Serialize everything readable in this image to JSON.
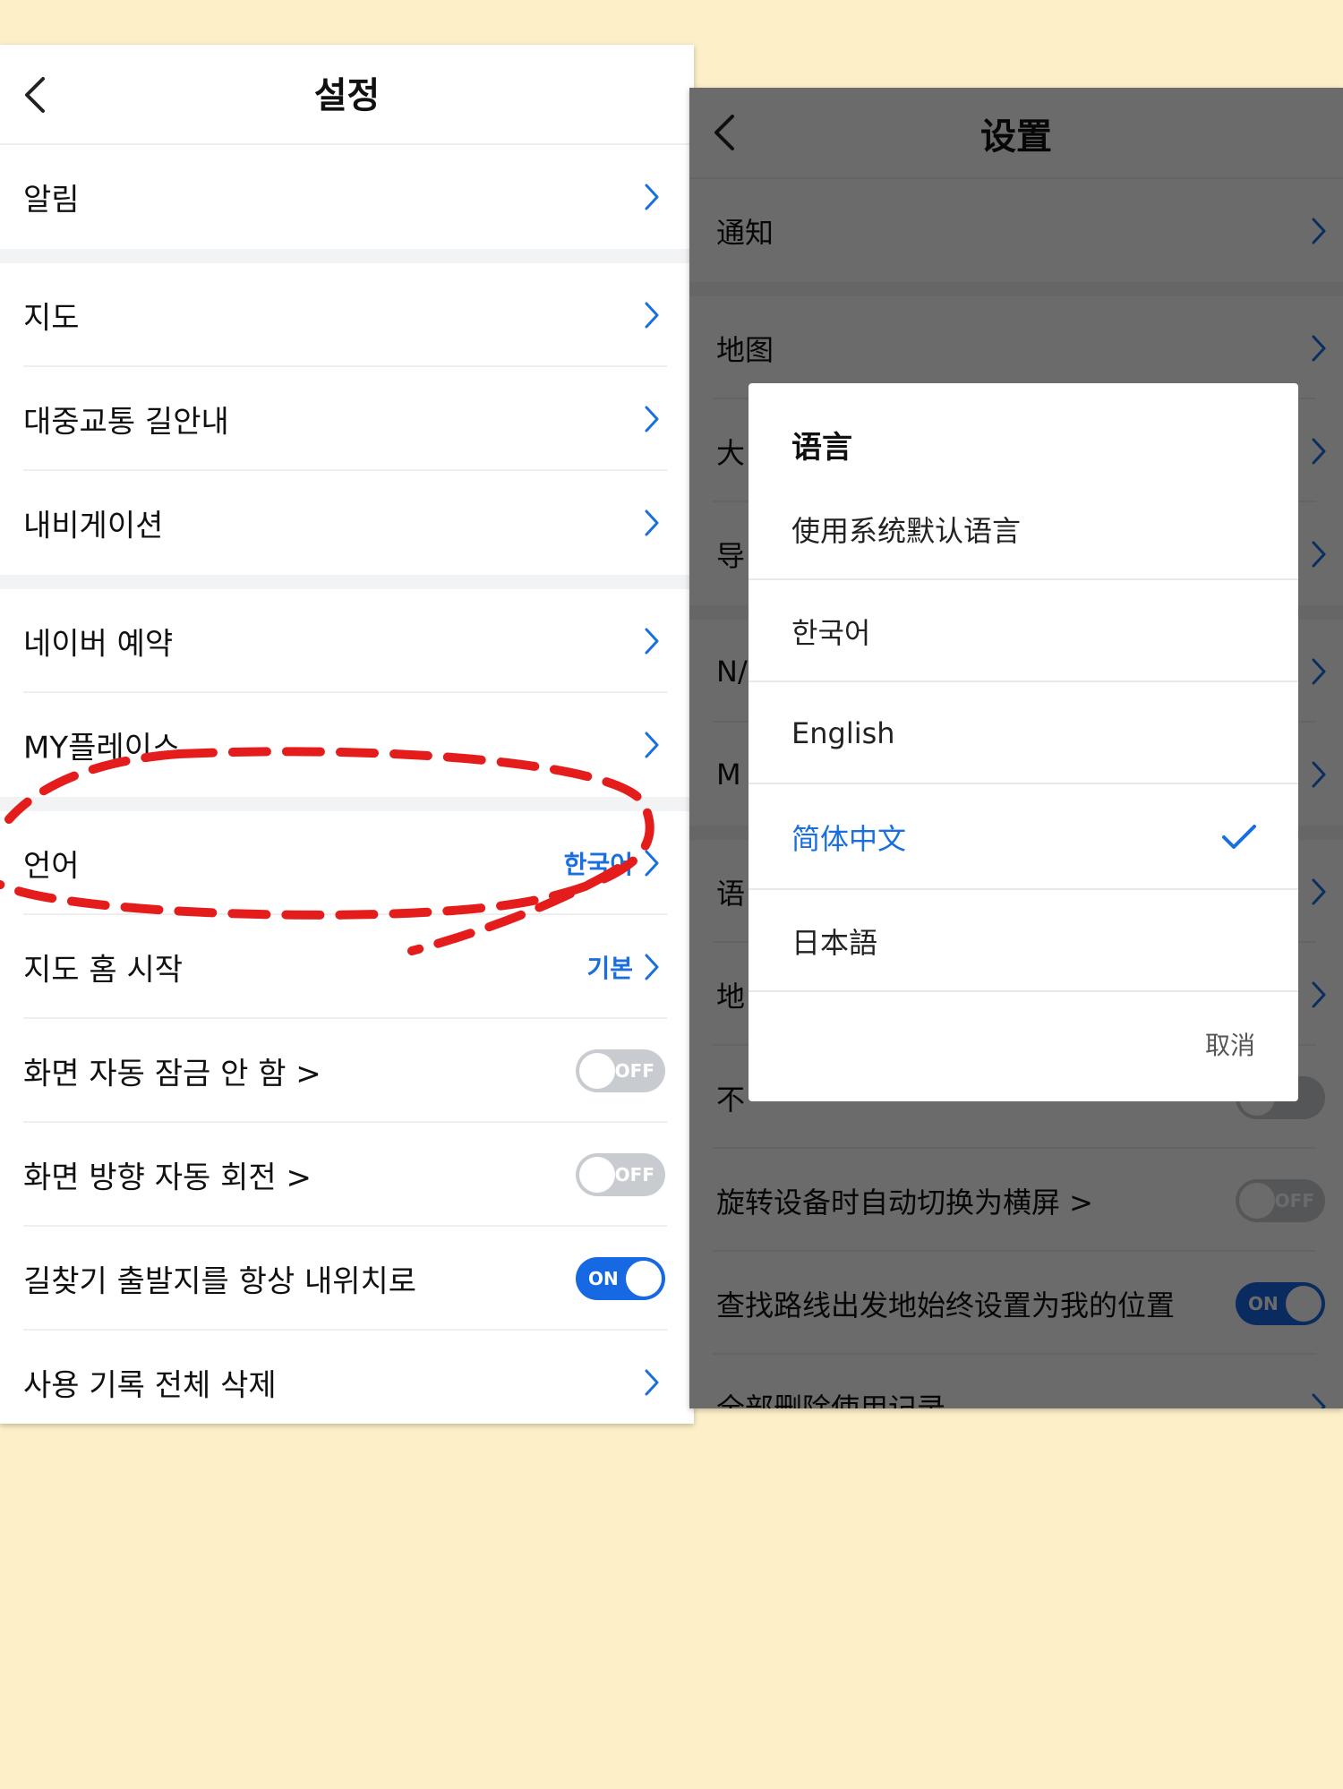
{
  "left_screen": {
    "title": "설정",
    "rows": {
      "notifications": "알림",
      "map": "지도",
      "transit": "대중교통 길안내",
      "navigation": "내비게이션",
      "naver_booking": "네이버 예약",
      "my_place": "MY플레이스",
      "language": "언어",
      "language_value": "한국어",
      "map_home": "지도 홈 시작",
      "map_home_value": "기본",
      "auto_lock": "화면 자동 잠금 안 함 >",
      "auto_lock_toggle": "OFF",
      "auto_rotate": "화면 방향 자동 회전 >",
      "auto_rotate_toggle": "OFF",
      "start_my_location": "길찾기 출발지를 항상 내위치로",
      "start_my_location_toggle": "ON",
      "clear_history": "사용 기록 전체 삭제"
    }
  },
  "right_screen": {
    "title": "设置",
    "rows": {
      "notifications": "通知",
      "map": "地图",
      "transit_partial": "大",
      "navigation_partial": "导",
      "naver_partial": "N/",
      "my_place_partial": "M",
      "language_partial": "语",
      "map_home_partial": "地",
      "auto_lock_partial": "不",
      "auto_rotate": "旋转设备时自动切换为横屏 >",
      "auto_rotate_toggle": "OFF",
      "start_my_location": "查找路线出发地始终设置为我的位置",
      "start_my_location_toggle": "ON",
      "clear_history": "全部删除使用记录"
    },
    "language_dialog": {
      "title": "语言",
      "options": [
        "使用系统默认语言",
        "한국어",
        "English",
        "简体中文",
        "日本語"
      ],
      "selected": "简体中文",
      "cancel": "取消"
    }
  },
  "colors": {
    "background": "#fdf0c9",
    "accent_blue": "#1a6fe0",
    "annotation_red": "#e51c1c"
  }
}
